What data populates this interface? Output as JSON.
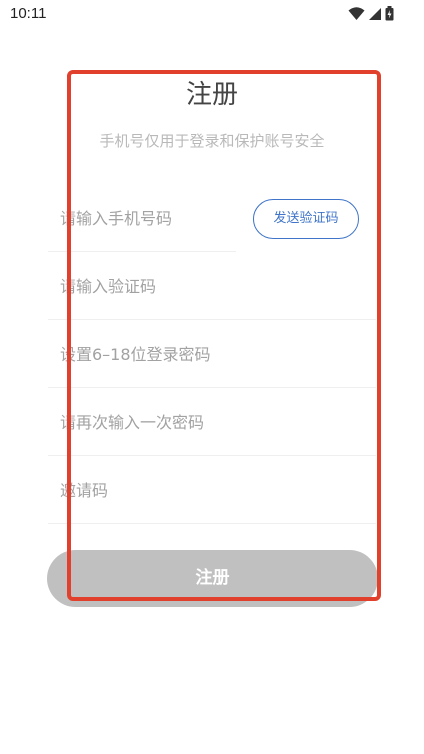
{
  "status_bar": {
    "time": "10:11",
    "icons": [
      "wifi-icon",
      "signal-icon",
      "battery-icon"
    ]
  },
  "page": {
    "title": "注册",
    "subtitle": "手机号仅用于登录和保护账号安全"
  },
  "form": {
    "phone_placeholder": "请输入手机号码",
    "send_code_label": "发送验证码",
    "code_placeholder": "请输入验证码",
    "password_placeholder": "设置6–18位登录密码",
    "confirm_password_placeholder": "请再次输入一次密码",
    "invite_placeholder": "邀请码",
    "submit_label": "注册"
  },
  "colors": {
    "accent": "#3f74c9",
    "submit_disabled": "#c0c0c0",
    "highlight": "#e1412c"
  }
}
